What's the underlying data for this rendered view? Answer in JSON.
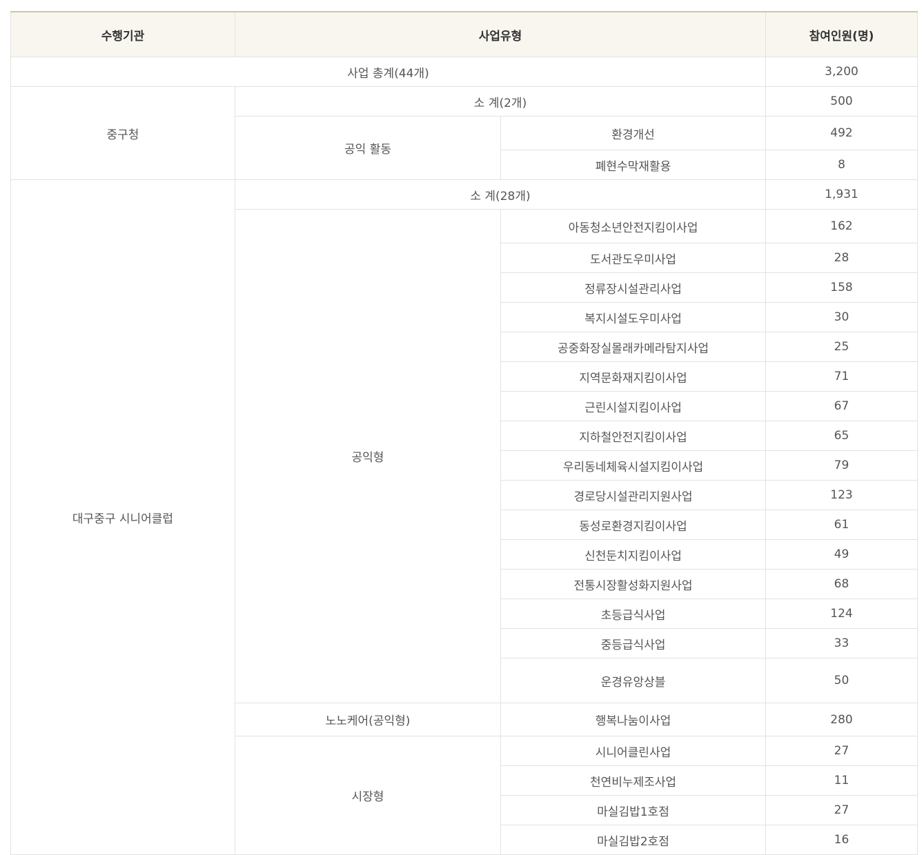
{
  "headers": {
    "org": "수행기관",
    "type": "사업유형",
    "count": "참여인원(명)"
  },
  "total": {
    "label": "사업 총계(44개)",
    "value": "3,200"
  },
  "junggu": {
    "org": "중구청",
    "subtotal": {
      "label": "소 계(2개)",
      "value": "500"
    },
    "category": "공익 활동",
    "items": [
      {
        "name": "환경개선",
        "value": "492"
      },
      {
        "name": "폐현수막재활용",
        "value": "8"
      }
    ]
  },
  "senior": {
    "org": "대구중구 시니어클럽",
    "subtotal": {
      "label": "소 계(28개)",
      "value": "1,931"
    },
    "public": {
      "category": "공익형",
      "items": [
        {
          "name": "아동청소년안전지킴이사업",
          "value": "162"
        },
        {
          "name": "도서관도우미사업",
          "value": "28"
        },
        {
          "name": "정류장시설관리사업",
          "value": "158"
        },
        {
          "name": "복지시설도우미사업",
          "value": "30"
        },
        {
          "name": "공중화장실몰래카메라탐지사업",
          "value": "25"
        },
        {
          "name": "지역문화재지킴이사업",
          "value": "71"
        },
        {
          "name": "근린시설지킴이사업",
          "value": "67"
        },
        {
          "name": "지하철안전지킴이사업",
          "value": "65"
        },
        {
          "name": "우리동네체육시설지킴이사업",
          "value": "79"
        },
        {
          "name": "경로당시설관리지원사업",
          "value": "123"
        },
        {
          "name": "동성로환경지킴이사업",
          "value": "61"
        },
        {
          "name": "신천둔치지킴이사업",
          "value": "49"
        },
        {
          "name": "전통시장활성화지원사업",
          "value": "68"
        },
        {
          "name": "초등급식사업",
          "value": "124"
        },
        {
          "name": "중등급식사업",
          "value": "33"
        },
        {
          "name": "운경유앙상블",
          "value": "50"
        }
      ]
    },
    "nocare": {
      "category": "노노케어(공익형)",
      "name": "행복나눔이사업",
      "value": "280"
    },
    "market": {
      "category": "시장형",
      "items": [
        {
          "name": "시니어클린사업",
          "value": "27"
        },
        {
          "name": "천연비누제조사업",
          "value": "11"
        },
        {
          "name": "마실김밥1호점",
          "value": "27"
        },
        {
          "name": "마실김밥2호점",
          "value": "16"
        }
      ]
    }
  }
}
